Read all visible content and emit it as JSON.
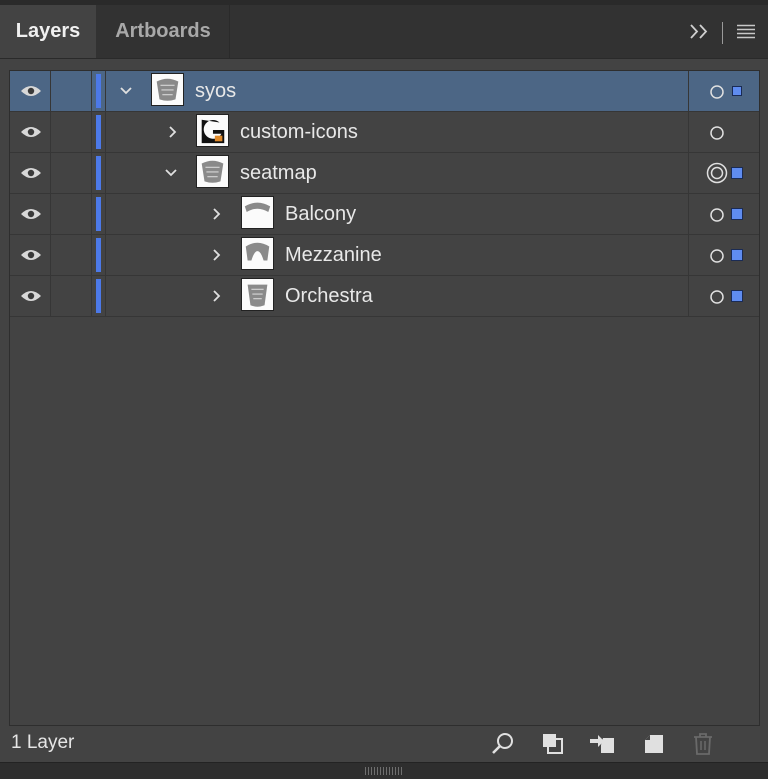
{
  "tabs": [
    {
      "label": "Layers",
      "active": true
    },
    {
      "label": "Artboards",
      "active": false
    }
  ],
  "toolbar": {
    "expand_icon": "double-chevron-right-icon",
    "menu_icon": "hamburger-menu-icon"
  },
  "layers": [
    {
      "name": "syos",
      "depth": 0,
      "expanded": true,
      "selected": true,
      "target": "circle",
      "color_square": true,
      "thumb": "seatmap-thumb"
    },
    {
      "name": "custom-icons",
      "depth": 1,
      "expanded": false,
      "selected": false,
      "target": "circle",
      "color_square": false,
      "thumb": "icon-thumb"
    },
    {
      "name": "seatmap",
      "depth": 1,
      "expanded": true,
      "selected": false,
      "target": "double-circle",
      "color_square": true,
      "thumb": "seatmap-thumb"
    },
    {
      "name": "Balcony",
      "depth": 2,
      "expanded": false,
      "selected": false,
      "target": "circle",
      "color_square": true,
      "thumb": "balcony-thumb"
    },
    {
      "name": "Mezzanine",
      "depth": 2,
      "expanded": false,
      "selected": false,
      "target": "circle",
      "color_square": true,
      "thumb": "mezzanine-thumb"
    },
    {
      "name": "Orchestra",
      "depth": 2,
      "expanded": false,
      "selected": false,
      "target": "circle",
      "color_square": true,
      "thumb": "orchestra-thumb"
    }
  ],
  "footer": {
    "layer_count": "1 Layer",
    "buttons": [
      "locate-object-icon",
      "make-clipping-mask-icon",
      "create-sublayer-icon",
      "create-new-layer-icon",
      "delete-layer-icon"
    ]
  },
  "colors": {
    "layer_color": "#4c79e8",
    "selected_row": "#4c6685",
    "panel_bg": "#434343"
  }
}
